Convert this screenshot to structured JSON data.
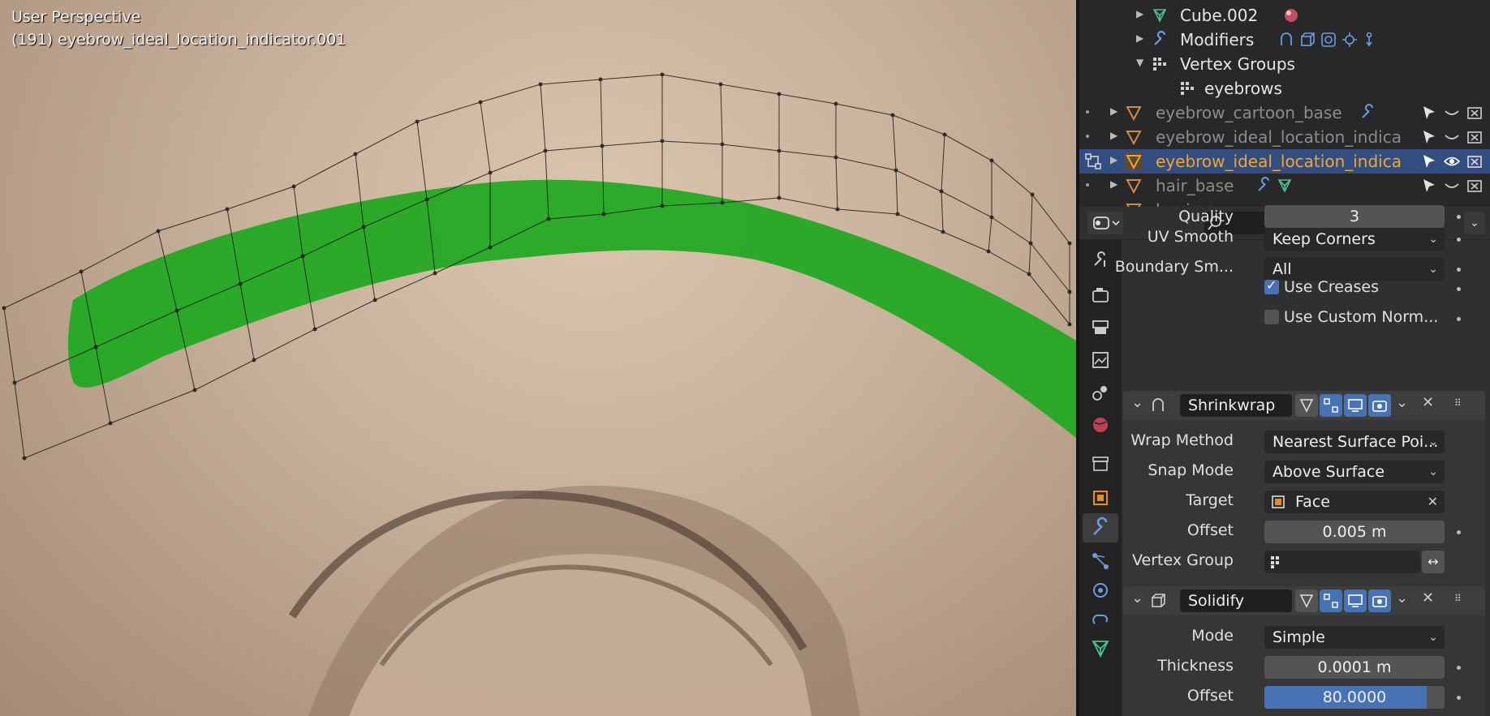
{
  "viewport": {
    "mode": "User Perspective",
    "object_info": "(191) eyebrow_ideal_location_indicator.001"
  },
  "outliner": {
    "rows": [
      {
        "label": "Cube.002",
        "icon": "mesh-data-icon"
      },
      {
        "label": "Modifiers",
        "icon": "wrench-icon"
      },
      {
        "label": "Vertex Groups",
        "icon": "vertex-groups-icon"
      },
      {
        "label": "eyebrows",
        "icon": "vertex-groups-icon"
      },
      {
        "label": "eyebrow_cartoon_base",
        "icon": "mesh-object-icon"
      },
      {
        "label": "eyebrow_ideal_location_indica",
        "icon": "mesh-object-icon"
      },
      {
        "label": "eyebrow_ideal_location_indica",
        "icon": "mesh-object-icon",
        "selected": true
      },
      {
        "label": "hair_base",
        "icon": "mesh-object-icon"
      },
      {
        "label": "lacrima",
        "icon": "mesh-object-icon"
      }
    ]
  },
  "properties": {
    "subdivision": {
      "quality_label": "Quality",
      "quality_value": "3",
      "uv_smooth_label": "UV Smooth",
      "uv_smooth_value": "Keep Corners",
      "boundary_label": "Boundary Sm...",
      "boundary_value": "All",
      "use_creases_label": "Use Creases",
      "use_creases": true,
      "use_custom_normals_label": "Use Custom Norm...",
      "use_custom_normals": false
    },
    "shrinkwrap": {
      "name": "Shrinkwrap",
      "wrap_method_label": "Wrap Method",
      "wrap_method_value": "Nearest Surface Poi...",
      "snap_mode_label": "Snap Mode",
      "snap_mode_value": "Above Surface",
      "target_label": "Target",
      "target_value": "Face",
      "offset_label": "Offset",
      "offset_value": "0.005 m",
      "vertex_group_label": "Vertex Group",
      "vertex_group_value": ""
    },
    "solidify": {
      "name": "Solidify",
      "mode_label": "Mode",
      "mode_value": "Simple",
      "thickness_label": "Thickness",
      "thickness_value": "0.0001 m",
      "offset_label": "Offset",
      "offset_value": "80.0000"
    }
  },
  "colors": {
    "accent_blue": "#4772b3",
    "selected_row": "#334d80",
    "active_name": "#f5a623",
    "eyebrow_green": "#1fa81f"
  }
}
